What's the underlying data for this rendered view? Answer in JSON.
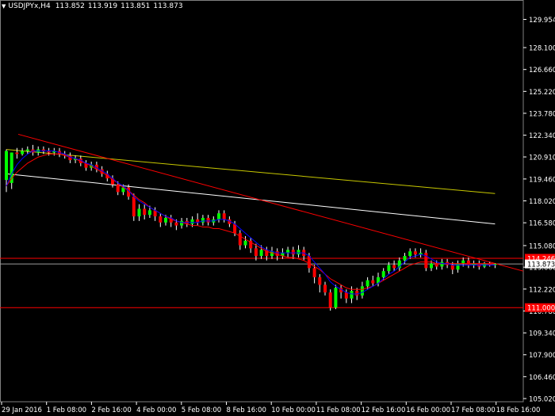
{
  "header": {
    "symbol": "USDJPYx,H4",
    "open": "113.852",
    "high": "113.919",
    "low": "113.851",
    "close": "113.873"
  },
  "colors": {
    "background": "#000000",
    "bull_candle": "#00ff00",
    "bear_candle": "#ff0000",
    "trendline": "#ff0000",
    "ma_fast": "#0000ff",
    "ma_mid": "#ff0000",
    "ma_yellow": "#c8c800",
    "ma_white": "#ffffff",
    "axis_text": "#ffffff"
  },
  "chart_data": {
    "type": "candlestick",
    "ylim": [
      105.02,
      130.5
    ],
    "y_ticks": [
      "129.954",
      "128.100",
      "126.660",
      "125.220",
      "123.780",
      "122.340",
      "120.910",
      "119.460",
      "118.020",
      "116.580",
      "115.080",
      "113.660",
      "112.220",
      "110.780",
      "109.340",
      "107.900",
      "106.460",
      "105.020"
    ],
    "x_ticks": [
      "29 Jan 2016",
      "1 Feb 08:00",
      "2 Feb 16:00",
      "4 Feb 00:00",
      "5 Feb 08:00",
      "8 Feb 16:00",
      "10 Feb 00:00",
      "11 Feb 08:00",
      "12 Feb 16:00",
      "16 Feb 00:00",
      "17 Feb 08:00",
      "18 Feb 16:00"
    ],
    "price_tags": [
      {
        "label": "114.246",
        "value": 114.246
      },
      {
        "label": "113.873",
        "value": 113.873
      },
      {
        "label": "111.000",
        "value": 111.0
      }
    ],
    "hlines": [
      114.246,
      113.873,
      111.0
    ],
    "trendline": {
      "from": [
        0,
        122.4
      ],
      "to": [
        89,
        113.4
      ]
    },
    "candles": [
      [
        119.4,
        121.3,
        121.4,
        118.6
      ],
      [
        119.2,
        121.2,
        121.2,
        118.8
      ],
      [
        121.2,
        121.1,
        121.5,
        120.8
      ],
      [
        121.1,
        121.3,
        121.5,
        121.0
      ],
      [
        121.3,
        121.4,
        121.6,
        121.1
      ],
      [
        121.4,
        121.2,
        121.7,
        121.0
      ],
      [
        121.2,
        121.4,
        121.6,
        121.0
      ],
      [
        121.4,
        121.3,
        121.6,
        121.1
      ],
      [
        121.3,
        121.2,
        121.5,
        121.0
      ],
      [
        121.2,
        121.3,
        121.5,
        121.0
      ],
      [
        121.3,
        121.1,
        121.5,
        120.9
      ],
      [
        121.1,
        121.0,
        121.3,
        120.8
      ],
      [
        121.0,
        120.7,
        121.2,
        120.5
      ],
      [
        120.7,
        120.8,
        121.0,
        120.5
      ],
      [
        120.8,
        120.5,
        121.0,
        120.3
      ],
      [
        120.5,
        120.2,
        120.7,
        120.0
      ],
      [
        120.2,
        120.4,
        120.6,
        120.0
      ],
      [
        120.4,
        120.1,
        120.6,
        119.9
      ],
      [
        120.1,
        119.8,
        120.3,
        119.6
      ],
      [
        119.8,
        119.5,
        120.0,
        119.3
      ],
      [
        119.5,
        119.1,
        119.7,
        118.9
      ],
      [
        119.1,
        118.6,
        119.3,
        118.4
      ],
      [
        118.6,
        118.9,
        119.1,
        118.4
      ],
      [
        118.9,
        118.3,
        119.1,
        118.1
      ],
      [
        118.3,
        117.0,
        118.5,
        116.7
      ],
      [
        117.0,
        117.5,
        117.8,
        116.7
      ],
      [
        117.5,
        117.1,
        117.8,
        116.8
      ],
      [
        117.1,
        117.4,
        117.7,
        116.9
      ],
      [
        117.4,
        117.0,
        117.6,
        116.7
      ],
      [
        117.0,
        116.6,
        117.2,
        116.3
      ],
      [
        116.6,
        116.9,
        117.1,
        116.4
      ],
      [
        116.9,
        116.6,
        117.1,
        116.3
      ],
      [
        116.6,
        116.4,
        116.8,
        116.1
      ],
      [
        116.4,
        116.7,
        116.9,
        116.2
      ],
      [
        116.7,
        116.5,
        116.9,
        116.3
      ],
      [
        116.5,
        116.8,
        117.0,
        116.3
      ],
      [
        116.8,
        116.6,
        117.2,
        116.4
      ],
      [
        116.6,
        116.9,
        117.1,
        116.4
      ],
      [
        116.9,
        116.6,
        117.1,
        116.4
      ],
      [
        116.6,
        116.8,
        117.0,
        116.4
      ],
      [
        116.8,
        117.2,
        117.4,
        116.6
      ],
      [
        117.2,
        116.8,
        117.4,
        116.6
      ],
      [
        116.8,
        116.5,
        117.0,
        116.3
      ],
      [
        116.5,
        115.9,
        116.7,
        115.7
      ],
      [
        115.9,
        115.1,
        116.1,
        114.8
      ],
      [
        115.1,
        115.4,
        115.7,
        114.9
      ],
      [
        115.4,
        114.9,
        115.6,
        114.6
      ],
      [
        114.9,
        114.4,
        115.2,
        114.1
      ],
      [
        114.4,
        114.8,
        115.1,
        114.2
      ],
      [
        114.8,
        114.4,
        115.0,
        114.1
      ],
      [
        114.4,
        114.7,
        115.0,
        114.2
      ],
      [
        114.7,
        114.4,
        114.9,
        114.1
      ],
      [
        114.4,
        114.6,
        114.9,
        114.2
      ],
      [
        114.6,
        114.8,
        115.0,
        114.3
      ],
      [
        114.8,
        114.5,
        115.0,
        114.2
      ],
      [
        114.5,
        114.8,
        115.1,
        114.3
      ],
      [
        114.8,
        114.4,
        115.0,
        114.1
      ],
      [
        114.4,
        113.6,
        114.6,
        113.3
      ],
      [
        113.6,
        113.0,
        113.8,
        112.6
      ],
      [
        113.0,
        112.5,
        113.2,
        112.0
      ],
      [
        112.5,
        112.0,
        112.7,
        111.8
      ],
      [
        112.0,
        111.0,
        112.2,
        110.8
      ],
      [
        111.0,
        112.3,
        112.5,
        110.9
      ],
      [
        112.3,
        112.0,
        112.5,
        111.6
      ],
      [
        112.0,
        111.6,
        112.2,
        111.3
      ],
      [
        111.6,
        112.1,
        112.4,
        111.3
      ],
      [
        112.1,
        111.8,
        112.3,
        111.5
      ],
      [
        111.8,
        112.4,
        112.7,
        111.6
      ],
      [
        112.4,
        112.8,
        113.0,
        112.2
      ],
      [
        112.8,
        112.6,
        113.1,
        112.4
      ],
      [
        112.6,
        113.0,
        113.3,
        112.4
      ],
      [
        113.0,
        113.4,
        113.6,
        112.8
      ],
      [
        113.4,
        113.8,
        114.0,
        113.2
      ],
      [
        113.8,
        113.6,
        114.1,
        113.4
      ],
      [
        113.6,
        114.1,
        114.3,
        113.4
      ],
      [
        114.1,
        114.4,
        114.6,
        113.9
      ],
      [
        114.4,
        114.7,
        114.9,
        114.2
      ],
      [
        114.7,
        114.5,
        114.9,
        114.3
      ],
      [
        114.5,
        114.6,
        114.9,
        114.3
      ],
      [
        114.6,
        113.6,
        114.8,
        113.4
      ],
      [
        113.6,
        113.9,
        114.1,
        113.4
      ],
      [
        113.9,
        113.7,
        114.1,
        113.5
      ],
      [
        113.7,
        114.0,
        114.2,
        113.5
      ],
      [
        114.0,
        113.8,
        114.2,
        113.6
      ],
      [
        113.8,
        113.5,
        114.0,
        113.2
      ],
      [
        113.5,
        113.9,
        114.1,
        113.3
      ],
      [
        113.9,
        114.1,
        114.3,
        113.7
      ],
      [
        114.1,
        113.8,
        114.3,
        113.6
      ],
      [
        113.8,
        113.9,
        114.1,
        113.6
      ],
      [
        113.9,
        113.7,
        114.1,
        113.5
      ],
      [
        113.7,
        113.9,
        114.0,
        113.6
      ],
      [
        113.9,
        113.8,
        114.0,
        113.7
      ],
      [
        113.8,
        113.873,
        113.919,
        113.6
      ]
    ],
    "ma_fast": [
      119.0,
      119.8,
      120.4,
      120.8,
      121.1,
      121.3,
      121.3,
      121.3,
      121.3,
      121.3,
      121.2,
      121.1,
      120.9,
      120.8,
      120.7,
      120.5,
      120.4,
      120.2,
      120.0,
      119.8,
      119.5,
      119.2,
      119.0,
      118.7,
      118.3,
      118.0,
      117.8,
      117.6,
      117.4,
      117.2,
      117.0,
      116.9,
      116.7,
      116.6,
      116.6,
      116.6,
      116.6,
      116.7,
      116.7,
      116.7,
      116.8,
      116.8,
      116.7,
      116.5,
      116.2,
      115.9,
      115.6,
      115.3,
      115.0,
      114.8,
      114.7,
      114.6,
      114.6,
      114.6,
      114.6,
      114.6,
      114.6,
      114.4,
      114.0,
      113.6,
      113.2,
      112.7,
      112.4,
      112.2,
      112.0,
      111.9,
      111.9,
      112.0,
      112.2,
      112.4,
      112.6,
      112.9,
      113.2,
      113.4,
      113.7,
      114.0,
      114.3,
      114.4,
      114.5,
      114.4,
      114.2,
      114.0,
      113.9,
      113.9,
      113.8,
      113.8,
      113.8,
      113.8,
      113.8,
      113.8,
      113.8,
      113.8,
      113.8
    ],
    "ma_mid": [
      119.0,
      119.5,
      119.9,
      120.2,
      120.5,
      120.7,
      120.9,
      121.0,
      121.1,
      121.1,
      121.1,
      121.0,
      120.9,
      120.8,
      120.6,
      120.5,
      120.3,
      120.1,
      119.9,
      119.7,
      119.4,
      119.2,
      118.9,
      118.7,
      118.4,
      118.1,
      117.9,
      117.6,
      117.4,
      117.2,
      117.0,
      116.8,
      116.7,
      116.6,
      116.5,
      116.4,
      116.4,
      116.3,
      116.3,
      116.2,
      116.2,
      116.1,
      116.0,
      115.9,
      115.7,
      115.5,
      115.3,
      115.1,
      114.9,
      114.7,
      114.6,
      114.5,
      114.4,
      114.3,
      114.3,
      114.2,
      114.1,
      113.9,
      113.7,
      113.5,
      113.2,
      112.9,
      112.7,
      112.5,
      112.3,
      112.2,
      112.2,
      112.2,
      112.3,
      112.4,
      112.6,
      112.8,
      113.0,
      113.2,
      113.4,
      113.6,
      113.8,
      113.9,
      114.0,
      114.0,
      114.0,
      113.9,
      113.9,
      113.9,
      113.9,
      113.9,
      113.9,
      113.9,
      113.9,
      113.9,
      113.9,
      113.9,
      113.9
    ],
    "ma_yellow": {
      "from": [
        0,
        121.4
      ],
      "to": [
        92,
        118.5
      ]
    },
    "ma_white": {
      "from": [
        0,
        119.8
      ],
      "to": [
        92,
        116.5
      ]
    }
  }
}
